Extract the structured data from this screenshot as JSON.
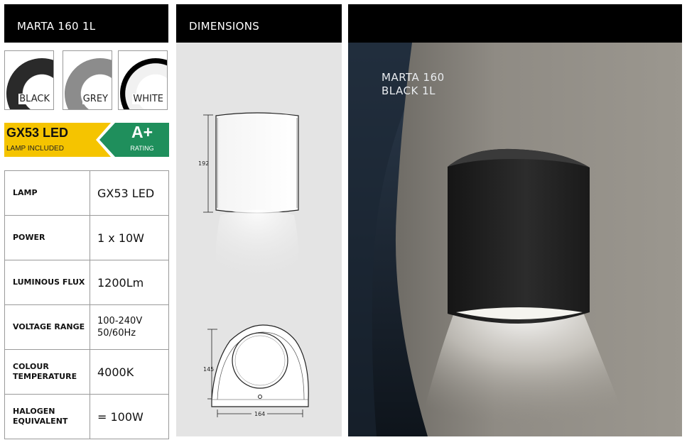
{
  "product": {
    "title": "MARTA 160 1L"
  },
  "finishes": [
    {
      "label": "BLACK",
      "color": "#1e1e1e"
    },
    {
      "label": "GREY",
      "color": "#7d7d7d"
    },
    {
      "label": "WHITE",
      "color": "#f2f2f2"
    }
  ],
  "badges": {
    "lamp": {
      "title": "GX53 LED",
      "subtitle": "LAMP INCLUDED",
      "color": "#f5c400"
    },
    "rating": {
      "title": "A+",
      "subtitle": "RATING",
      "color": "#1f8f5c"
    }
  },
  "specs": [
    {
      "key": "LAMP",
      "value": "GX53 LED"
    },
    {
      "key": "POWER",
      "value": "1 x 10W"
    },
    {
      "key": "LUMINOUS FLUX",
      "value": "1200Lm"
    },
    {
      "key": "VOLTAGE RANGE",
      "value": "100-240V 50/60Hz"
    },
    {
      "key": "COLOUR TEMPERATURE",
      "value": "4000K"
    },
    {
      "key": "HALOGEN EQUIVALENT",
      "value": "= 100W"
    }
  ],
  "dimensions": {
    "title": "DIMENSIONS",
    "height": "192",
    "depth": "145",
    "width": "164"
  },
  "photo": {
    "caption_line1": "MARTA 160",
    "caption_line2": "BLACK 1L"
  }
}
